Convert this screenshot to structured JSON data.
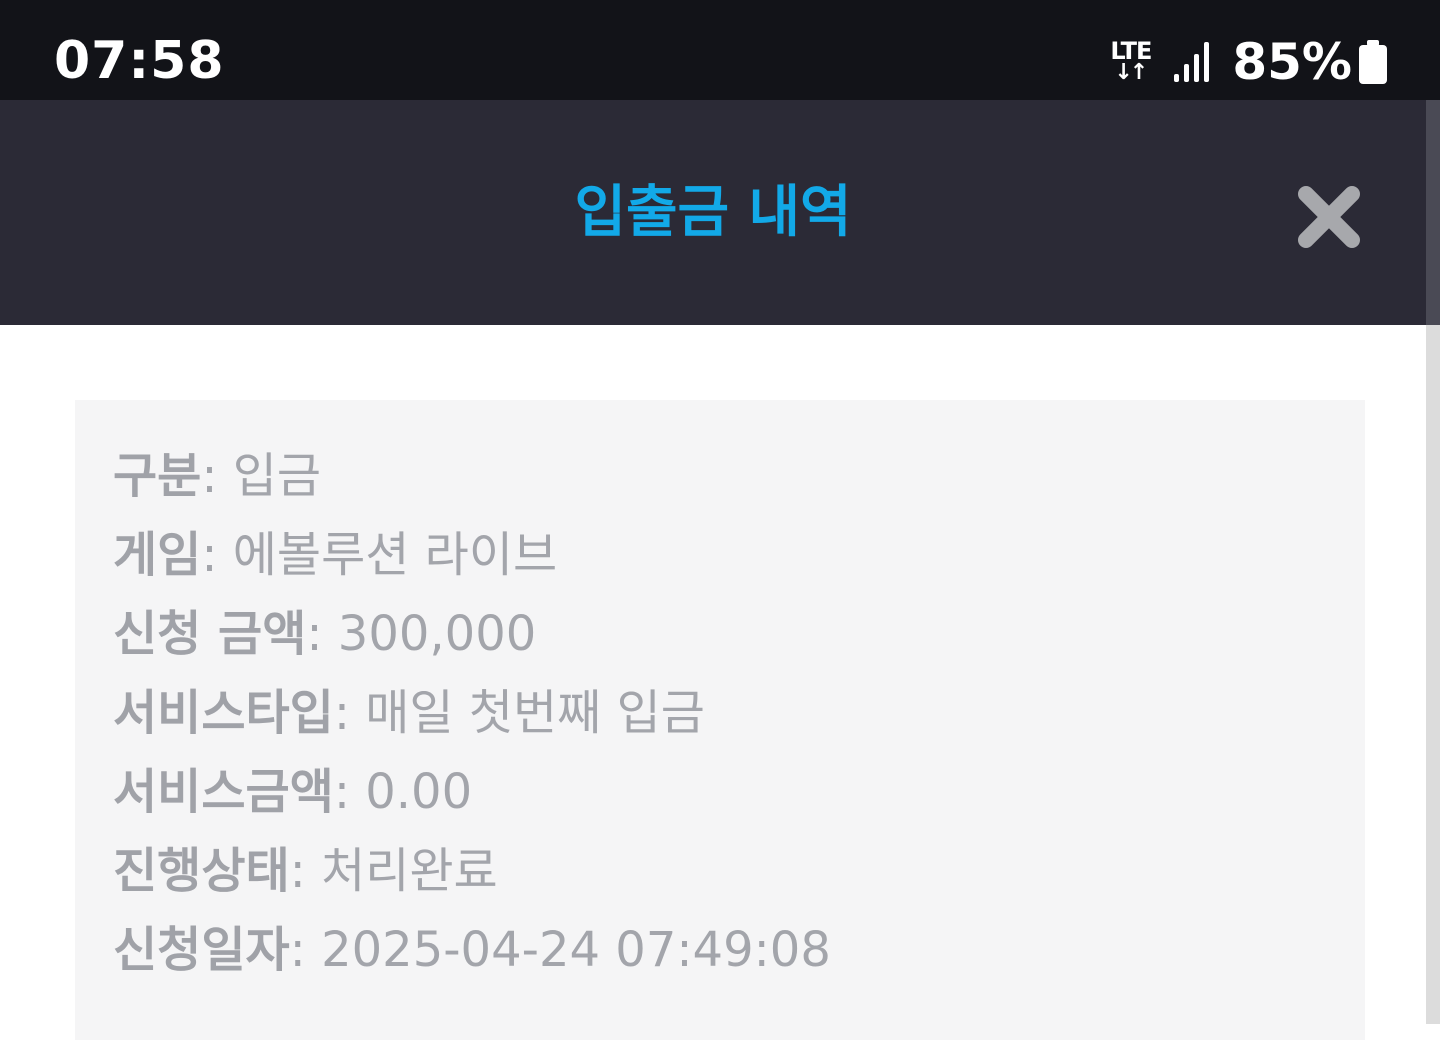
{
  "status_bar": {
    "time": "07:58",
    "network": "LTE",
    "network_arrows": "↓↑",
    "battery": "85%",
    "icons": [
      "lte-icon",
      "signal-icon",
      "battery-icon"
    ]
  },
  "modal": {
    "title": "입출금 내역",
    "close_icon": "close-icon",
    "title_color": "#12a9e8",
    "header_bg": "#2b2a36"
  },
  "details": {
    "rows": [
      {
        "label": "구분",
        "sep": ": ",
        "value": "입금"
      },
      {
        "label": "게임",
        "sep": ": ",
        "value": "에볼루션 라이브"
      },
      {
        "label": "신청 금액",
        "sep": ": ",
        "value": "300,000"
      },
      {
        "label": "서비스타입",
        "sep": ": ",
        "value": "매일 첫번째 입금"
      },
      {
        "label": "서비스금액",
        "sep": ": ",
        "value": "0.00"
      },
      {
        "label": "진행상태",
        "sep": ": ",
        "value": "처리완료"
      },
      {
        "label": "신청일자",
        "sep": ": ",
        "value": "2025-04-24 07:49:08"
      }
    ]
  }
}
